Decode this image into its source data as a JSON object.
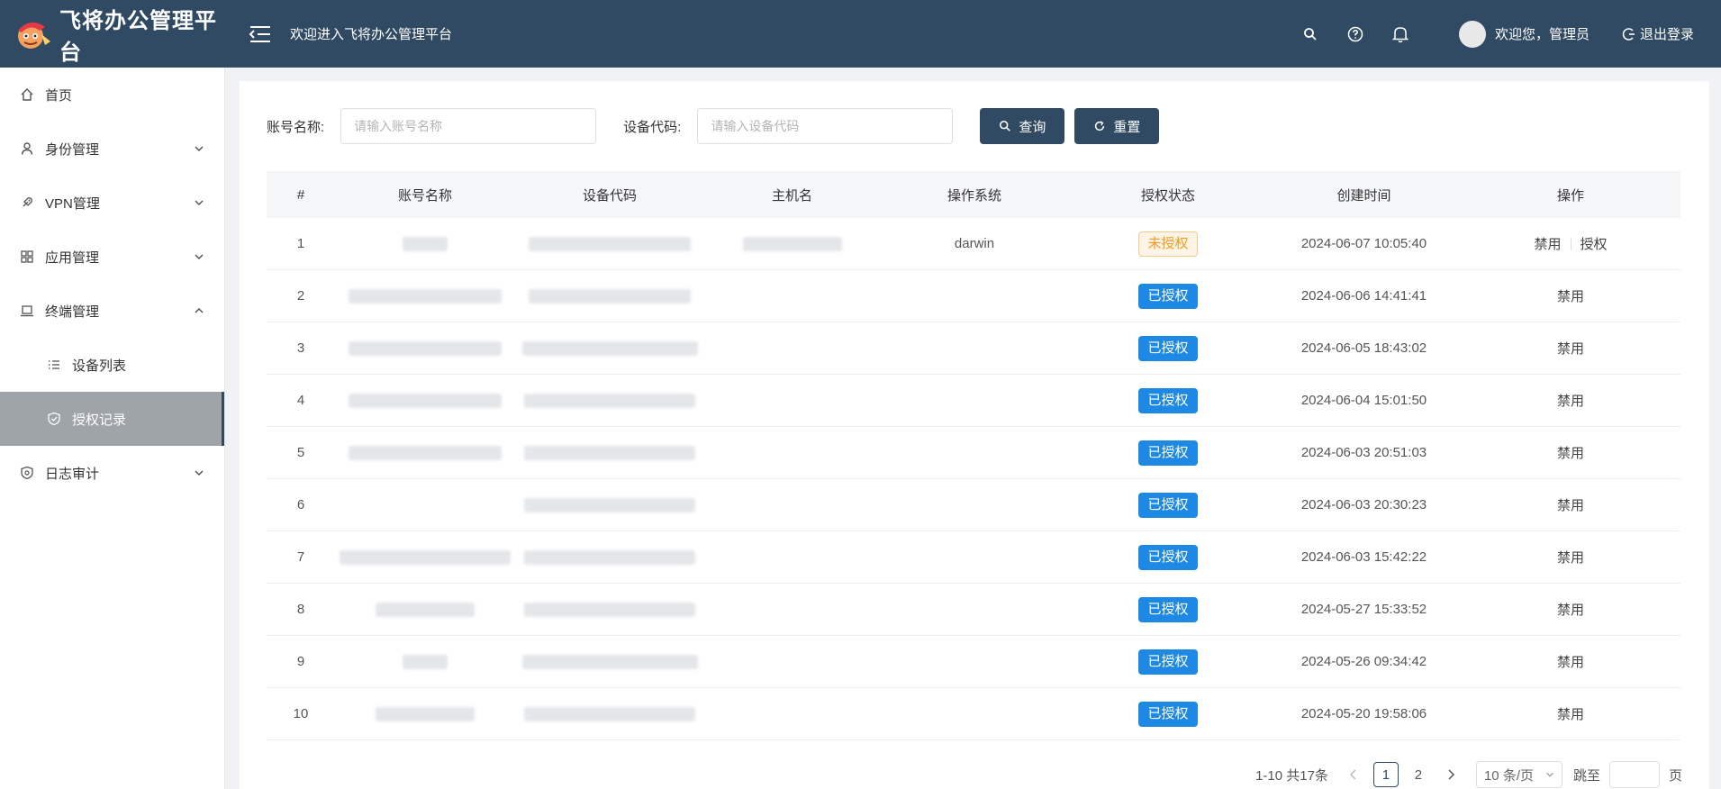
{
  "header": {
    "brand_title": "飞将办公管理平台",
    "welcome_text": "欢迎进入飞将办公管理平台",
    "user_text": "欢迎您，管理员",
    "logout_label": "退出登录"
  },
  "sidebar": {
    "items": [
      {
        "label": "首页",
        "icon": "home-icon"
      },
      {
        "label": "身份管理",
        "icon": "user-icon"
      },
      {
        "label": "VPN管理",
        "icon": "rocket-icon"
      },
      {
        "label": "应用管理",
        "icon": "apps-icon"
      },
      {
        "label": "终端管理",
        "icon": "laptop-icon"
      },
      {
        "label": "设备列表",
        "icon": "list-icon"
      },
      {
        "label": "授权记录",
        "icon": "shield-check-icon"
      },
      {
        "label": "日志审计",
        "icon": "shield-icon"
      }
    ]
  },
  "filter": {
    "account_label": "账号名称:",
    "account_placeholder": "请输入账号名称",
    "device_label": "设备代码:",
    "device_placeholder": "请输入设备代码",
    "search_label": "查询",
    "reset_label": "重置"
  },
  "table": {
    "columns": [
      "#",
      "账号名称",
      "设备代码",
      "主机名",
      "操作系统",
      "授权状态",
      "创建时间",
      "操作"
    ],
    "rows": [
      {
        "index": "1",
        "os": "darwin",
        "status": "未授权",
        "created": "2024-06-07 10:05:40",
        "op1": "禁用",
        "op2": "授权"
      },
      {
        "index": "2",
        "os": "",
        "status": "已授权",
        "created": "2024-06-06 14:41:41",
        "op1": "禁用"
      },
      {
        "index": "3",
        "os": "",
        "status": "已授权",
        "created": "2024-06-05 18:43:02",
        "op1": "禁用"
      },
      {
        "index": "4",
        "os": "",
        "status": "已授权",
        "created": "2024-06-04 15:01:50",
        "op1": "禁用"
      },
      {
        "index": "5",
        "os": "",
        "status": "已授权",
        "created": "2024-06-03 20:51:03",
        "op1": "禁用"
      },
      {
        "index": "6",
        "os": "",
        "status": "已授权",
        "created": "2024-06-03 20:30:23",
        "op1": "禁用"
      },
      {
        "index": "7",
        "os": "",
        "status": "已授权",
        "created": "2024-06-03 15:42:22",
        "op1": "禁用"
      },
      {
        "index": "8",
        "os": "",
        "status": "已授权",
        "created": "2024-05-27 15:33:52",
        "op1": "禁用"
      },
      {
        "index": "9",
        "os": "",
        "status": "已授权",
        "created": "2024-05-26 09:34:42",
        "op1": "禁用"
      },
      {
        "index": "10",
        "os": "",
        "status": "已授权",
        "created": "2024-05-20 19:58:06",
        "op1": "禁用"
      }
    ]
  },
  "pager": {
    "total_text": "1-10 共17条",
    "page1": "1",
    "page2": "2",
    "size_text": "10 条/页",
    "jump_label": "跳至",
    "page_suffix": "页"
  },
  "colors": {
    "header_bg": "#304a63",
    "authorized": "#1e88e5",
    "unauthorized": "#f59a23"
  }
}
